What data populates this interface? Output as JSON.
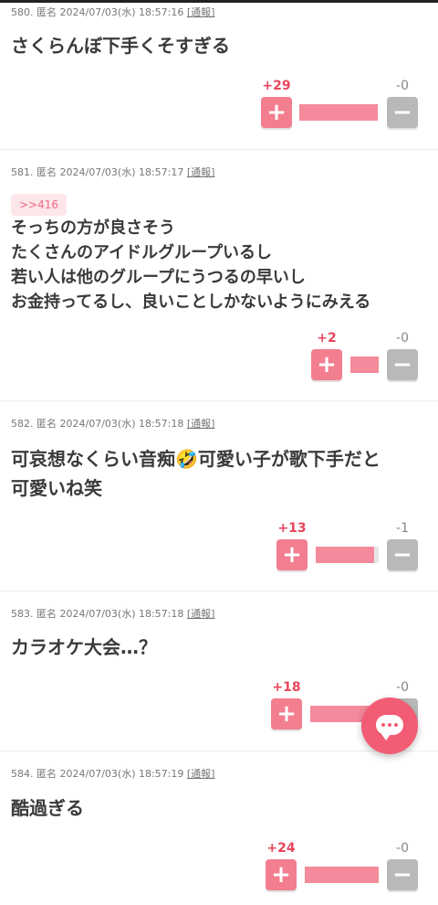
{
  "comments": [
    {
      "number": "580.",
      "author": "匿名",
      "datetime": "2024/07/03(水) 18:57:16",
      "report": "[通報]",
      "anchor": "",
      "lines": [
        "さくらんぼ下手くそすぎる"
      ],
      "plus": "+29",
      "minus": "-0",
      "plus_ratio": 1.0
    },
    {
      "number": "581.",
      "author": "匿名",
      "datetime": "2024/07/03(水) 18:57:17",
      "report": "[通報]",
      "anchor": ">>416",
      "lines": [
        "そっちの方が良さそう",
        "たくさんのアイドルグループいるし",
        "若い人は他のグループにうつるの早いし",
        "お金持ってるし、良いことしかないようにみえる"
      ],
      "plus": "+2",
      "minus": "-0",
      "plus_ratio": 1.0
    },
    {
      "number": "582.",
      "author": "匿名",
      "datetime": "2024/07/03(水) 18:57:18",
      "report": "[通報]",
      "anchor": "",
      "lines": [
        "可哀想なくらい音痴🤣可愛い子が歌下手だと",
        "可愛いね笑"
      ],
      "plus": "+13",
      "minus": "-1",
      "plus_ratio": 0.93
    },
    {
      "number": "583.",
      "author": "匿名",
      "datetime": "2024/07/03(水) 18:57:18",
      "report": "[通報]",
      "anchor": "",
      "lines": [
        "カラオケ大会…？"
      ],
      "plus": "+18",
      "minus": "-0",
      "plus_ratio": 1.0
    },
    {
      "number": "584.",
      "author": "匿名",
      "datetime": "2024/07/03(水) 18:57:19",
      "report": "[通報]",
      "anchor": "",
      "lines": [
        "酷過ぎる"
      ],
      "plus": "+24",
      "minus": "-0",
      "plus_ratio": 1.0
    }
  ],
  "buttons": {
    "plus_symbol": "+",
    "minus_symbol": "−"
  },
  "colors": {
    "accent": "#f25c74",
    "plus": "#f27e8f",
    "minus": "#b9b9b9",
    "plus_count": "#e8455b"
  },
  "icons": {
    "fab": "comment-bubble-icon"
  }
}
